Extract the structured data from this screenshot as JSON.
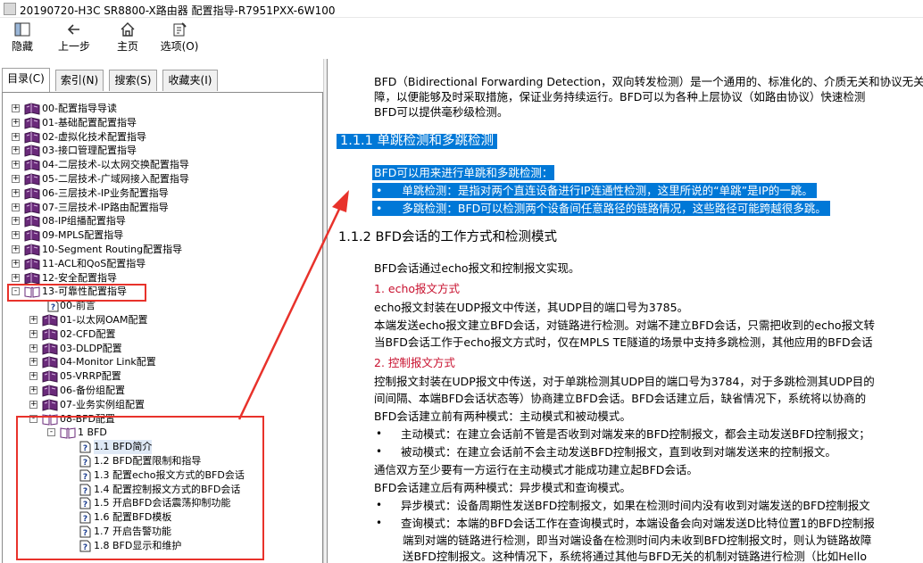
{
  "window": {
    "title": "20190720-H3C SR8800-X路由器 配置指导-R7951PXX-6W100"
  },
  "toolbar": {
    "hide": "隐藏",
    "back": "上一步",
    "home": "主页",
    "options": "选项(O)"
  },
  "tabs": [
    "目录(C)",
    "索引(N)",
    "搜索(S)",
    "收藏夹(I)"
  ],
  "tree": {
    "top_items": [
      "00-配置指导导读",
      "01-基础配置配置指导",
      "02-虚拟化技术配置指导",
      "03-接口管理配置指导",
      "04-二层技术-以太网交换配置指导",
      "05-二层技术-广域网接入配置指导",
      "06-三层技术-IP业务配置指导",
      "07-三层技术-IP路由配置指导",
      "08-IP组播配置指导",
      "09-MPLS配置指导",
      "10-Segment Routing配置指导",
      "11-ACL和QoS配置指导",
      "12-安全配置指导"
    ],
    "open_book": "13-可靠性配置指导",
    "preface": "00-前言",
    "sub_items": [
      "01-以太网OAM配置",
      "02-CFD配置",
      "03-DLDP配置",
      "04-Monitor Link配置",
      "05-VRRP配置",
      "06-备份组配置",
      "07-业务实例组配置"
    ],
    "bfd_chapter": "08-BFD配置",
    "bfd_section": "1 BFD",
    "bfd_topics": [
      "1.1  BFD简介",
      "1.2  BFD配置限制和指导",
      "1.3  配置echo报文方式的BFD会话",
      "1.4  配置控制报文方式的BFD会话",
      "1.5  开启BFD会话震荡抑制功能",
      "1.6  配置BFD模板",
      "1.7  开启告警功能",
      "1.8  BFD显示和维护"
    ]
  },
  "content": {
    "intro_1": "BFD（Bidirectional Forwarding Detection，双向转发检测）是一个通用的、标准化的、介质无关和协议无关的",
    "intro_2": "障，以便能够及时采取措施，保证业务持续运行。BFD可以为各种上层协议（如路由协议）快速检测",
    "intro_3": "BFD可以提供毫秒级检测。",
    "h_111": "1.1.1  单跳检测和多跳检测",
    "s_line": "BFD可以用来进行单跳和多跳检测：",
    "s_b1": "单跳检测：是指对两个直连设备进行IP连通性检测，这里所说的“单跳”是IP的一跳。",
    "s_b2": "多跳检测：BFD可以检测两个设备间任意路径的链路情况，这些路径可能跨越很多跳。",
    "h_112": "1.1.2  BFD会话的工作方式和检测模式",
    "p_1": "BFD会话通过echo报文和控制报文实现。",
    "sub_1": "1. echo报文方式",
    "p_2": "echo报文封装在UDP报文中传送，其UDP目的端口号为3785。",
    "p_3": "本端发送echo报文建立BFD会话，对链路进行检测。对端不建立BFD会话，只需把收到的echo报文转",
    "p_4": "当BFD会话工作于echo报文方式时，仅在MPLS TE隧道的场景中支持多跳检测，其他应用的BFD会话",
    "sub_2": "2. 控制报文方式",
    "p_5": "控制报文封装在UDP报文中传送，对于单跳检测其UDP目的端口号为3784，对于多跳检测其UDP目的",
    "p_6": "间间隔、本端BFD会话状态等）协商建立BFD会话。BFD会话建立后，缺省情况下，系统将以协商的",
    "p_7": "BFD会话建立前有两种模式：主动模式和被动模式。",
    "b_1": "主动模式：在建立会话前不管是否收到对端发来的BFD控制报文，都会主动发送BFD控制报文；",
    "b_2": "被动模式：在建立会话前不会主动发送BFD控制报文，直到收到对端发送来的控制报文。",
    "p_8": "通信双方至少要有一方运行在主动模式才能成功建立起BFD会话。",
    "p_9": "BFD会话建立后有两种模式：异步模式和查询模式。",
    "b_3": "异步模式：设备周期性发送BFD控制报文，如果在检测时间内没有收到对端发送的BFD控制报文",
    "b_4": "查询模式：本端的BFD会话工作在查询模式时，本端设备会向对端发送D比特位置1的BFD控制报",
    "b_4b": "端到对端的链路进行检测，即当对端设备在检测时间内未收到BFD控制报文时，则认为链路故障",
    "b_4c": "送BFD控制报文。这种情况下，系统将通过其他与BFD无关的机制对链路进行检测（比如Hello",
    "bullet": "•"
  },
  "colors": {
    "selection": "#0078d7",
    "heading_red": "#c8102e",
    "annotation_red": "#e8322b"
  }
}
